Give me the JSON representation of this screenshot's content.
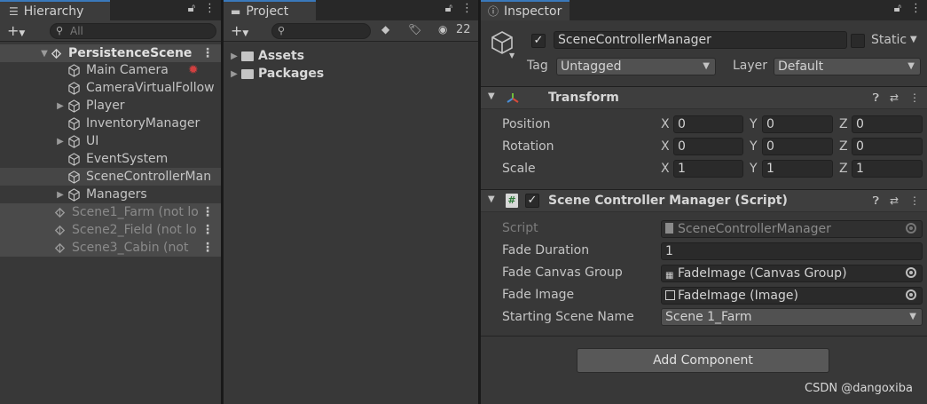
{
  "hierarchy": {
    "tab_label": "Hierarchy",
    "search_placeholder": "All",
    "rows": [
      {
        "label": "PersistenceScene",
        "kind": "scene"
      },
      {
        "label": "Main Camera",
        "kind": "object"
      },
      {
        "label": "CameraVirtualFollow",
        "kind": "object"
      },
      {
        "label": "Player",
        "kind": "object-collapsed"
      },
      {
        "label": "InventoryManager",
        "kind": "object"
      },
      {
        "label": "UI",
        "kind": "object-collapsed"
      },
      {
        "label": "EventSystem",
        "kind": "object"
      },
      {
        "label": "SceneControllerMan",
        "kind": "selected"
      },
      {
        "label": "Managers",
        "kind": "object-collapsed"
      },
      {
        "label": "Scene1_Farm (not lo",
        "kind": "unloaded"
      },
      {
        "label": "Scene2_Field (not lo",
        "kind": "unloaded"
      },
      {
        "label": "Scene3_Cabin (not",
        "kind": "unloaded"
      }
    ]
  },
  "project": {
    "tab_label": "Project",
    "hidden_count": "22",
    "folders": [
      "Assets",
      "Packages"
    ]
  },
  "inspector": {
    "tab_label": "Inspector",
    "object_name": "SceneControllerManager",
    "static_label": "Static",
    "tag_label": "Tag",
    "tag_value": "Untagged",
    "layer_label": "Layer",
    "layer_value": "Default",
    "transform": {
      "title": "Transform",
      "position_label": "Position",
      "rotation_label": "Rotation",
      "scale_label": "Scale",
      "position": {
        "x": "0",
        "y": "0",
        "z": "0"
      },
      "rotation": {
        "x": "0",
        "y": "0",
        "z": "0"
      },
      "scale": {
        "x": "1",
        "y": "1",
        "z": "1"
      }
    },
    "script_component": {
      "title": "Scene Controller Manager (Script)",
      "script_label": "Script",
      "script_value": "SceneControllerManager",
      "fade_duration_label": "Fade Duration",
      "fade_duration_value": "1",
      "fade_canvas_group_label": "Fade Canvas Group",
      "fade_canvas_group_value": "FadeImage (Canvas Group)",
      "fade_image_label": "Fade Image",
      "fade_image_value": "FadeImage (Image)",
      "starting_scene_label": "Starting Scene Name",
      "starting_scene_value": "Scene 1_Farm"
    },
    "add_component_label": "Add Component",
    "axis_labels": {
      "x": "X",
      "y": "Y",
      "z": "Z"
    }
  },
  "watermark": "CSDN @dangoxiba",
  "colors": {
    "accent": "#3a79bb",
    "panel": "#383838",
    "field": "#2a2a2a"
  }
}
